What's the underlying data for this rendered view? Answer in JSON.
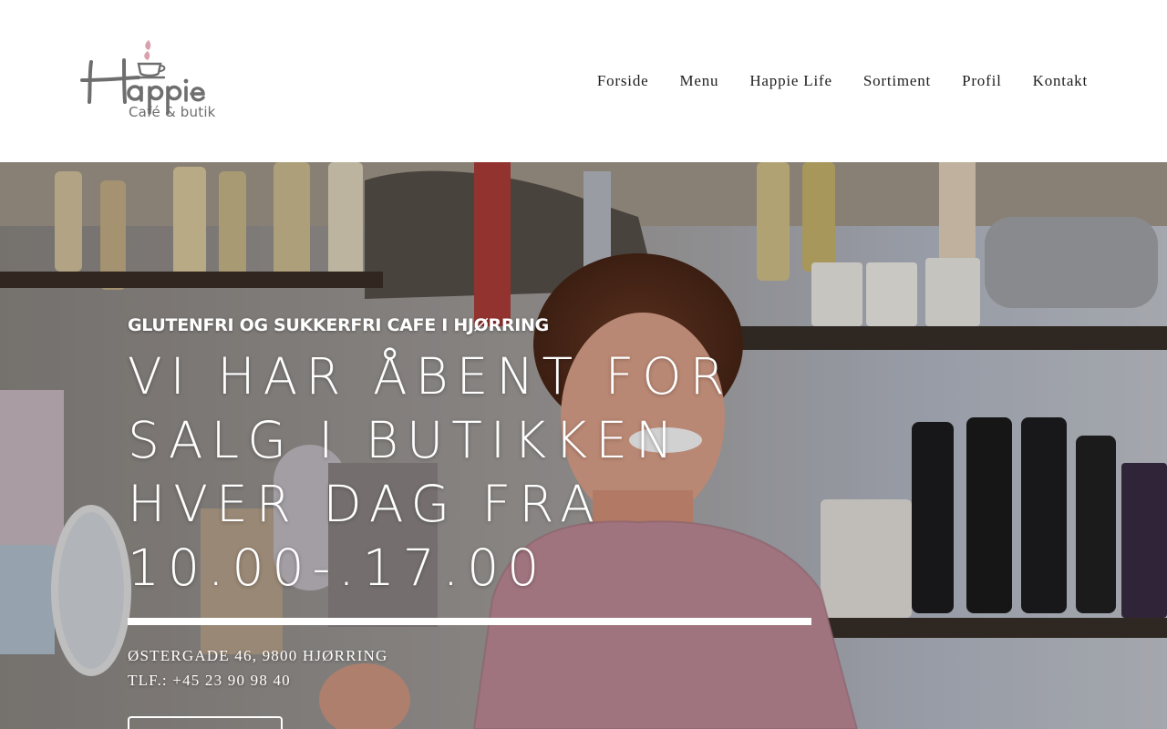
{
  "brand": {
    "logo_main": "Happie",
    "logo_sub": "Café & butik",
    "logo_color": "#6e6e6e",
    "accent_color": "#d9a0ad"
  },
  "nav": {
    "items": [
      {
        "label": "Forside"
      },
      {
        "label": "Menu"
      },
      {
        "label": "Happie Life"
      },
      {
        "label": "Sortiment"
      },
      {
        "label": "Profil"
      },
      {
        "label": "Kontakt"
      }
    ]
  },
  "hero": {
    "kicker": "GLUTENFRI OG SUKKERFRI CAFE I HJØRRING",
    "headline": "VI HAR ÅBENT FOR SALG I BUTIKKEN HVER DAG FRA 10.00-.17.00",
    "address_line": "ØSTERGADE 46, 9800 HJØRRING",
    "phone_line": "TLF.: +45 23 90 98 40",
    "cta_label": ""
  }
}
